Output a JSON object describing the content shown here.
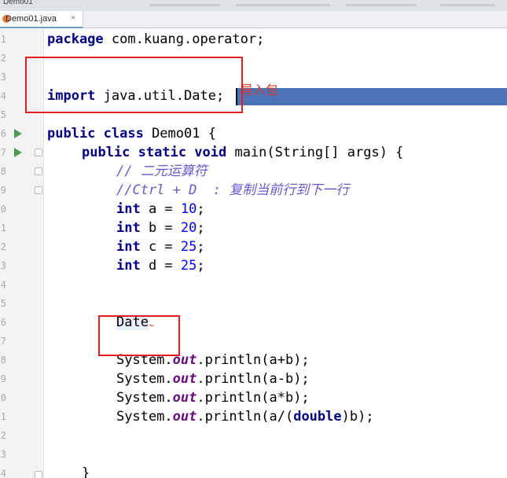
{
  "titlebar": {
    "project": "Demo01"
  },
  "tab": {
    "filename": "Demo01.java",
    "close": "×"
  },
  "gutter_numbers": [
    "1",
    "2",
    "3",
    "4",
    "5",
    "6",
    "7",
    "8",
    "9",
    "0",
    "1",
    "2",
    "3",
    "4",
    "5",
    "6",
    "7",
    "8",
    "9",
    "0",
    "1",
    "2",
    "3",
    "4"
  ],
  "code": {
    "package_kw": "package",
    "package_name": " com.kuang.operator;",
    "import_kw": "import",
    "import_path": " java.util.",
    "import_class": "Date",
    "import_semi": ";",
    "class_mods": "public class",
    "class_name": " Demo01 {",
    "main_mods": "public static void",
    "main_sig": " main(String[] args) {",
    "comment1": "// 二元运算符",
    "comment2": "//Ctrl + D  : 复制当前行到下一行",
    "decls": [
      {
        "type": "int",
        "rest": " a = ",
        "value": "10",
        "end": ";"
      },
      {
        "type": "int",
        "rest": " b = ",
        "value": "20",
        "end": ";"
      },
      {
        "type": "int",
        "rest": " c = ",
        "value": "25",
        "end": ";"
      },
      {
        "type": "int",
        "rest": " d = ",
        "value": "25",
        "end": ";"
      }
    ],
    "date_word": "Date",
    "squiggle": "~",
    "prints": [
      {
        "recv": "System.",
        "field": "out",
        "call": ".println(a+b);"
      },
      {
        "recv": "System.",
        "field": "out",
        "call": ".println(a-b);"
      },
      {
        "recv": "System.",
        "field": "out",
        "call": ".println(a*b);"
      },
      {
        "recv": "System.",
        "field": "out",
        "call": ".println(a/(",
        "kw": "double",
        "tail": ")b);"
      }
    ],
    "closing": "}"
  },
  "annotation": "导入包",
  "colors": {
    "keyword": "#000080",
    "comment": "#6a5acd",
    "number": "#0000ff",
    "field": "#660e7a",
    "highlight": "#4a73b8",
    "annotation_red": "#e02020",
    "run_green": "#499c54"
  }
}
